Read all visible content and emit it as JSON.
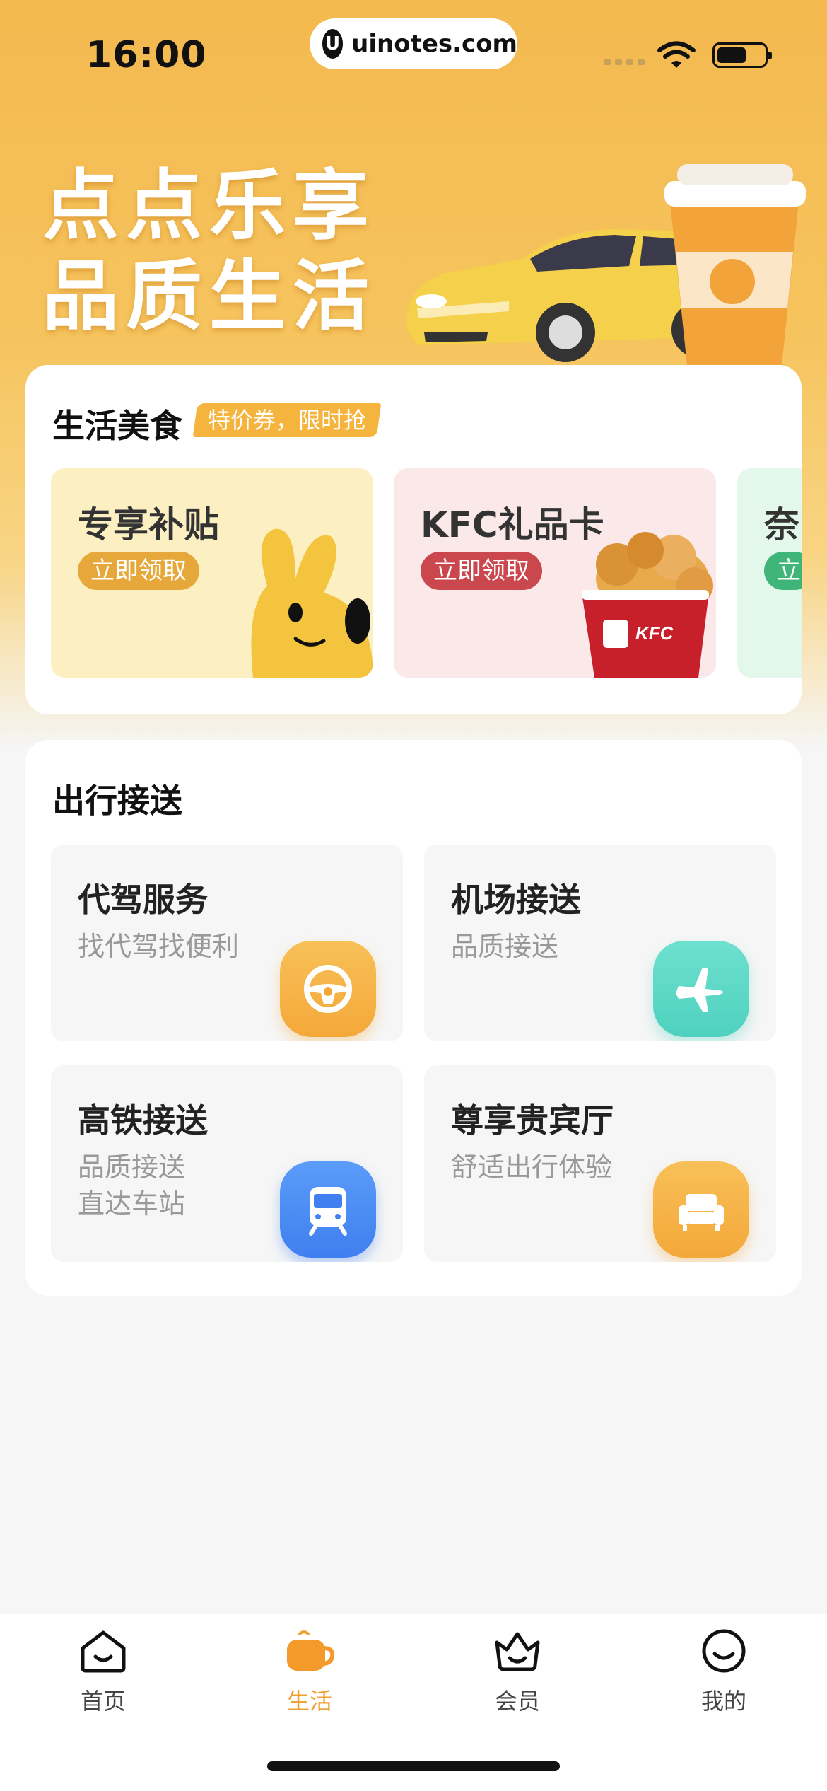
{
  "status_bar": {
    "time": "16:00",
    "site": "uinotes.com",
    "site_logo": "U"
  },
  "hero": {
    "line1": "点点乐享",
    "line2": "品质生活"
  },
  "food": {
    "title": "生活美食",
    "tag": "特价券，限时抢",
    "promos": [
      {
        "title": "专享补贴",
        "button": "立即领取"
      },
      {
        "title": "KFC礼品卡",
        "button": "立即领取",
        "bucket_text": "KFC"
      },
      {
        "title": "奈",
        "button": "立"
      }
    ]
  },
  "travel": {
    "title": "出行接送",
    "services": [
      {
        "title": "代驾服务",
        "subtitle": "找代驾找便利",
        "icon": "steering-wheel-icon"
      },
      {
        "title": "机场接送",
        "subtitle": "品质接送",
        "icon": "airplane-icon"
      },
      {
        "title": "高铁接送",
        "subtitle": "品质接送\n直达车站",
        "subtitle_line1": "品质接送",
        "subtitle_line2": "直达车站",
        "icon": "train-icon"
      },
      {
        "title": "尊享贵宾厅",
        "subtitle": "舒适出行体验",
        "icon": "sofa-icon"
      }
    ]
  },
  "tabbar": {
    "tabs": [
      {
        "label": "首页",
        "icon": "home-icon",
        "active": false
      },
      {
        "label": "生活",
        "icon": "cup-icon",
        "active": true
      },
      {
        "label": "会员",
        "icon": "crown-icon",
        "active": false
      },
      {
        "label": "我的",
        "icon": "smile-icon",
        "active": false
      }
    ]
  },
  "colors": {
    "accent": "#f0a030",
    "hero": "#f4b94f",
    "tag": "#f5b43d"
  }
}
